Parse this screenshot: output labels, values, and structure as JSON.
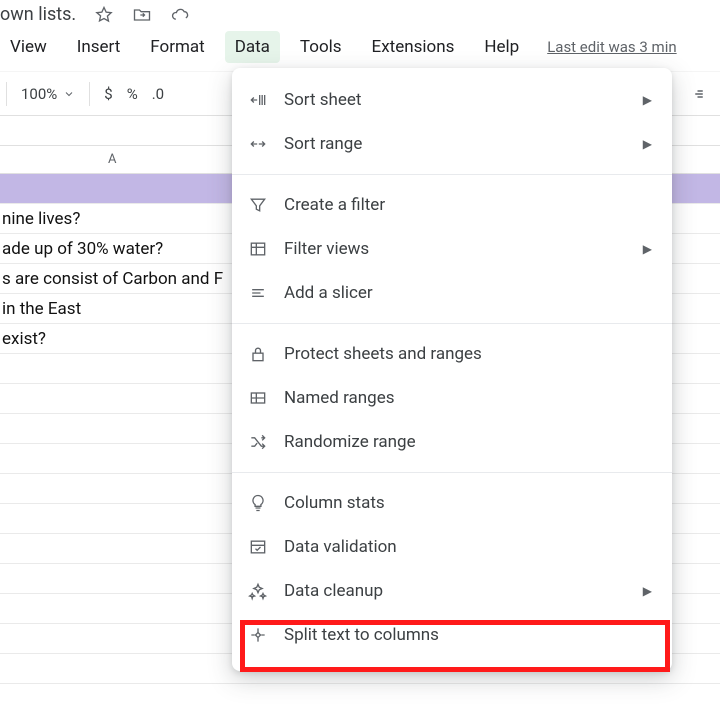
{
  "title": {
    "suffix": "own lists."
  },
  "menubar": {
    "view": "View",
    "insert": "Insert",
    "format": "Format",
    "data": "Data",
    "tools": "Tools",
    "extensions": "Extensions",
    "help": "Help",
    "last_edit": "Last edit was 3 min"
  },
  "toolbar": {
    "zoom": "100%",
    "currency": "$",
    "percent": "%",
    "decimal": ".0"
  },
  "columns": {
    "A": "A"
  },
  "rows": [
    "",
    "nine lives?",
    "ade up of 30% water?",
    "s are consist of Carbon and F",
    " in the East",
    " exist?"
  ],
  "data_menu": {
    "sort_sheet": "Sort sheet",
    "sort_range": "Sort range",
    "create_filter": "Create a filter",
    "filter_views": "Filter views",
    "add_slicer": "Add a slicer",
    "protect": "Protect sheets and ranges",
    "named_ranges": "Named ranges",
    "randomize": "Randomize range",
    "column_stats": "Column stats",
    "data_validation": "Data validation",
    "data_cleanup": "Data cleanup",
    "split_text": "Split text to columns"
  }
}
